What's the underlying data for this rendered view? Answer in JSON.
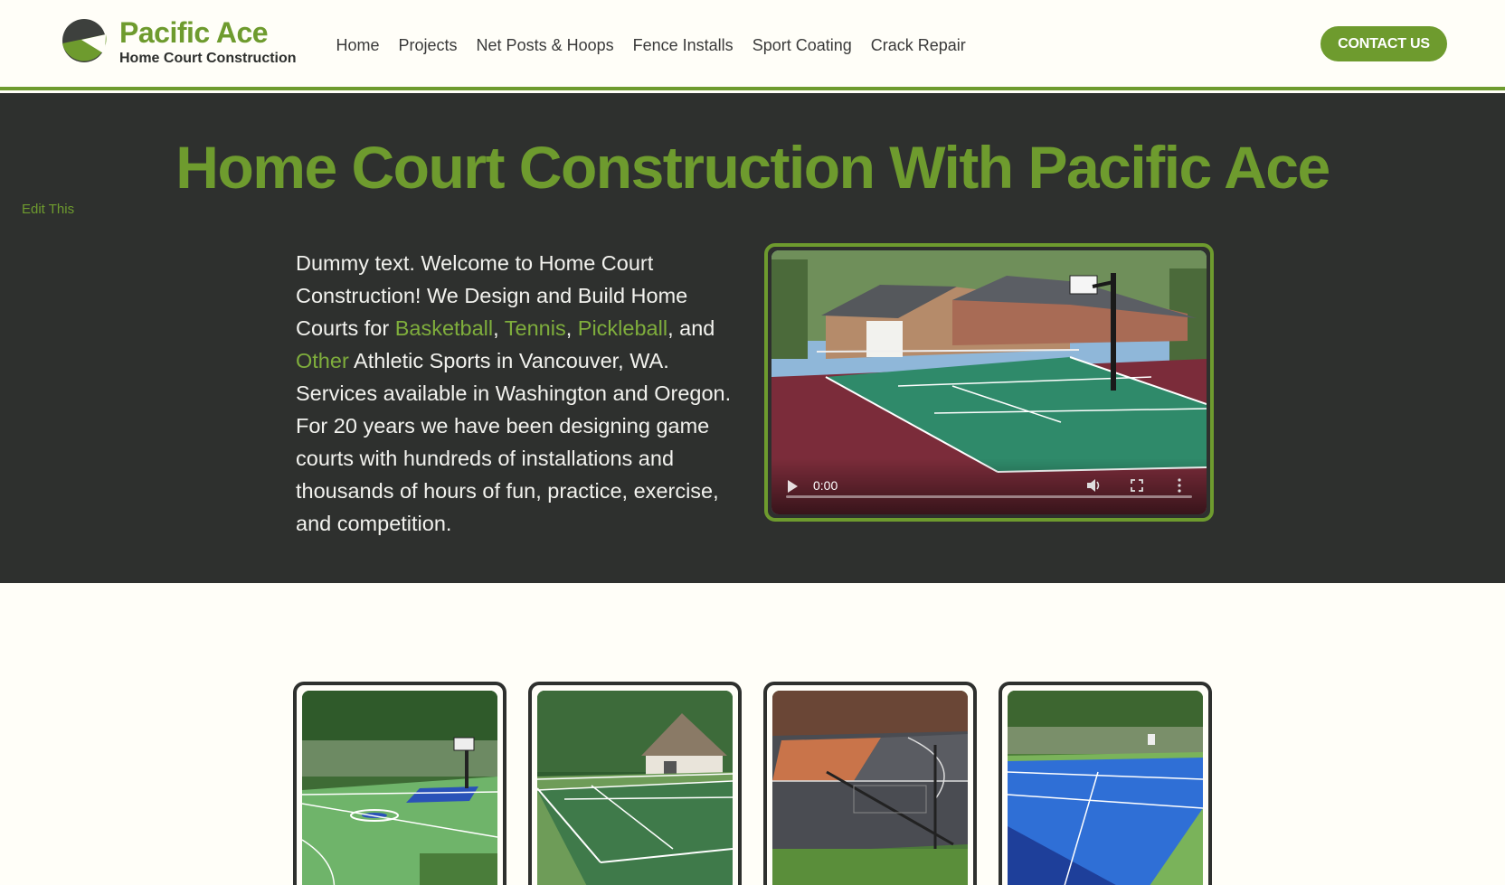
{
  "brand": {
    "name": "Pacific Ace",
    "tagline": "Home Court Construction"
  },
  "nav": {
    "items": [
      "Home",
      "Projects",
      "Net Posts & Hoops",
      "Fence Installs",
      "Sport Coating",
      "Crack Repair"
    ]
  },
  "header": {
    "contact_label": "CONTACT US"
  },
  "hero": {
    "title": "Home Court Construction With Pacific Ace",
    "edit_label": "Edit This",
    "text_before": "Dummy text. Welcome to Home Court Construction! We Design and Build Home Courts for ",
    "link_basketball": "Basketball",
    "sep1": ", ",
    "link_tennis": "Tennis",
    "sep2": ", ",
    "link_pickleball": "Pickleball",
    "sep3": ", and ",
    "link_other": "Other",
    "text_after": " Athletic Sports in Vancouver, WA. Services available in Washington and Oregon. For 20 years we have been designing game courts with hundreds of installations and thousands of hours of fun, practice, exercise, and competition."
  },
  "video": {
    "time": "0:00",
    "progress": 0
  },
  "colors": {
    "brand_green": "#6e9b2e",
    "dark_bg": "#2e302e",
    "page_bg": "#fffef8"
  },
  "icons": [
    "logo-mark-icon",
    "play-icon",
    "volume-icon",
    "fullscreen-icon",
    "more-vert-icon"
  ]
}
